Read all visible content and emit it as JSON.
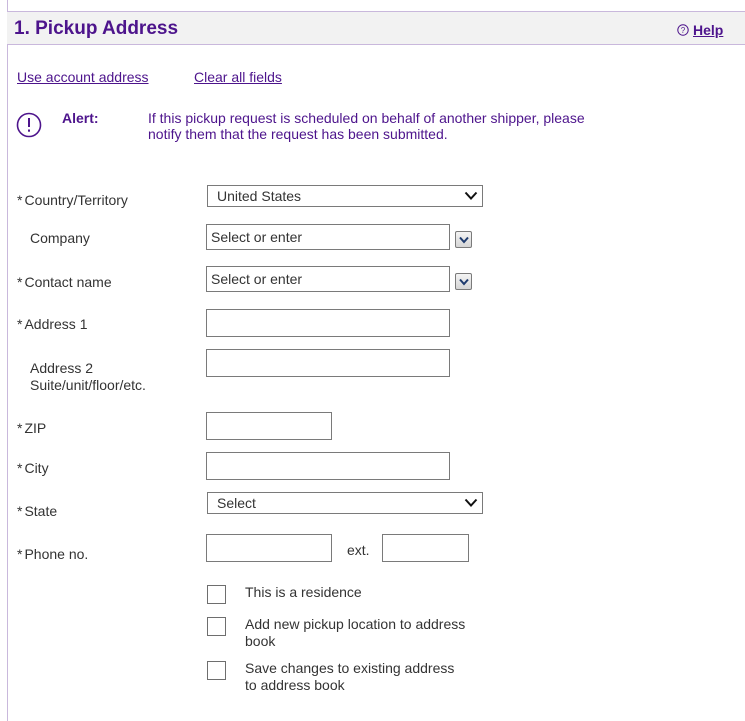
{
  "section": {
    "title": "1. Pickup Address",
    "help_label": "Help"
  },
  "links": {
    "use_account": "Use account address",
    "clear_all": "Clear all fields"
  },
  "alert": {
    "label": "Alert:",
    "message": "If this pickup request is scheduled on behalf of another shipper, please notify them that the request has been submitted."
  },
  "required_marker": "*",
  "fields": {
    "country": {
      "label": "Country/Territory",
      "value": "United States"
    },
    "company": {
      "label": "Company",
      "placeholder": "Select or enter"
    },
    "contact": {
      "label": "Contact name",
      "placeholder": "Select or enter"
    },
    "address1": {
      "label": "Address 1"
    },
    "address2": {
      "label": "Address 2",
      "sublabel": "Suite/unit/floor/etc."
    },
    "zip": {
      "label": "ZIP"
    },
    "city": {
      "label": "City"
    },
    "state": {
      "label": "State",
      "value": "Select"
    },
    "phone": {
      "label": "Phone no.",
      "ext_label": "ext."
    }
  },
  "checkboxes": {
    "residence": "This is a residence",
    "add_location": "Add new pickup location to address book",
    "save_changes": "Save changes to existing address to address book"
  },
  "colors": {
    "brand_purple": "#4d148c",
    "header_bg": "#f2f2f2",
    "border": "#c9b8dc"
  }
}
